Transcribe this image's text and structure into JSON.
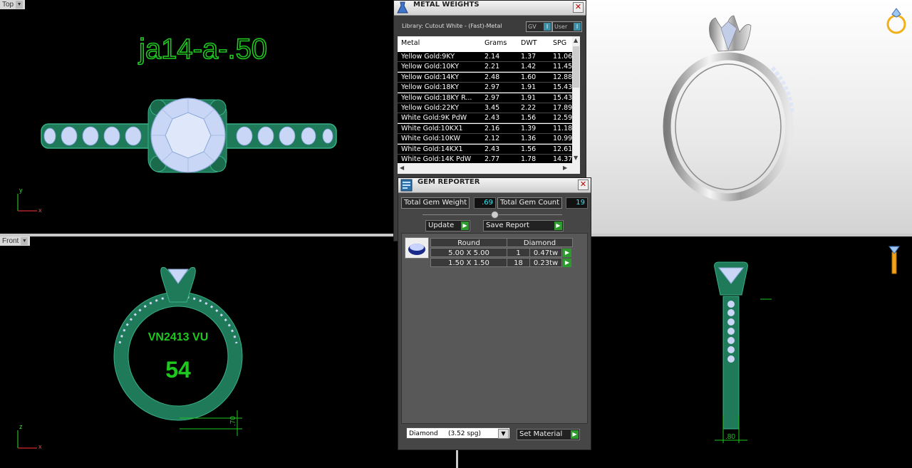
{
  "viewports": {
    "top": {
      "label": "Top",
      "annotation": "ja14-a-.50",
      "axis_y": "y",
      "axis_x": "x"
    },
    "front": {
      "label": "Front",
      "engraving_line1": "VN2413 VU",
      "engraving_line2": "54",
      "dimension": ".70",
      "axis_y": "z",
      "axis_x": "x"
    },
    "right": {
      "dimension": ".80"
    }
  },
  "metal_weights": {
    "title": "METAL WEIGHTS",
    "library": "Library: Cutout White - (Fast)-Metal",
    "gv_label": "GV",
    "user_label": "User",
    "indicator": "I",
    "columns": [
      "Metal",
      "Grams",
      "DWT",
      "SPG"
    ],
    "rows": [
      {
        "metal": "Yellow Gold:9KY",
        "grams": "2.14",
        "dwt": "1.37",
        "spg": "11.06"
      },
      {
        "metal": "Yellow Gold:10KY",
        "grams": "2.21",
        "dwt": "1.42",
        "spg": "11.45"
      },
      {
        "metal": "Yellow Gold:14KY",
        "grams": "2.48",
        "dwt": "1.60",
        "spg": "12.88"
      },
      {
        "metal": "Yellow Gold:18KY",
        "grams": "2.97",
        "dwt": "1.91",
        "spg": "15.43"
      },
      {
        "metal": "Yellow Gold:18KY R...",
        "grams": "2.97",
        "dwt": "1.91",
        "spg": "15.43"
      },
      {
        "metal": "Yellow Gold:22KY",
        "grams": "3.45",
        "dwt": "2.22",
        "spg": "17.89"
      },
      {
        "metal": "White Gold:9K PdW",
        "grams": "2.43",
        "dwt": "1.56",
        "spg": "12.59"
      },
      {
        "metal": "White Gold:10KX1",
        "grams": "2.16",
        "dwt": "1.39",
        "spg": "11.18"
      },
      {
        "metal": "White Gold:10KW",
        "grams": "2.12",
        "dwt": "1.36",
        "spg": "10.99"
      },
      {
        "metal": "White Gold:14KX1",
        "grams": "2.43",
        "dwt": "1.56",
        "spg": "12.61"
      },
      {
        "metal": "White Gold:14K PdW",
        "grams": "2.77",
        "dwt": "1.78",
        "spg": "14.37"
      }
    ]
  },
  "gem_reporter": {
    "title": "GEM REPORTER",
    "total_weight_label": "Total Gem Weight",
    "total_weight_value": ".69",
    "total_count_label": "Total Gem Count",
    "total_count_value": "19",
    "update_label": "Update",
    "save_report_label": "Save Report",
    "group_shape": "Round",
    "group_material": "Diamond",
    "gems": [
      {
        "size": "5.00 X 5.00",
        "count": "1",
        "weight": "0.47tw"
      },
      {
        "size": "1.50 X 1.50",
        "count": "18",
        "weight": "0.23tw"
      }
    ],
    "material_select": "Diamond     (3.52 spg)",
    "set_material_label": "Set Material"
  },
  "colors": {
    "ring_green": "#1f7a5a",
    "gem_blue": "#c9d6f5",
    "annotation_green": "#1fc81f",
    "value_cyan": "#3ee6f2"
  }
}
